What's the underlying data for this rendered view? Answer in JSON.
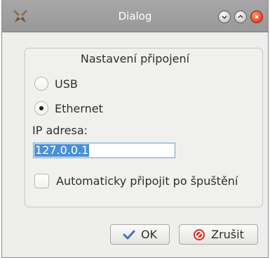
{
  "window": {
    "title": "Dialog"
  },
  "section": {
    "title": "Nastavení připojení"
  },
  "connection": {
    "options": [
      {
        "label": "USB",
        "selected": false
      },
      {
        "label": "Ethernet",
        "selected": true
      }
    ]
  },
  "ip": {
    "label": "IP adresa:",
    "value": "127.0.0.1"
  },
  "autoconnect": {
    "label": "Automaticky připojit po špuštění",
    "checked": false
  },
  "buttons": {
    "ok_label": "OK",
    "cancel_label": "Zrušit"
  },
  "icons": {
    "ok": "checkmark-icon",
    "cancel": "cancel-icon",
    "app": "app-icon",
    "minimize": "minimize-icon",
    "maximize": "maximize-icon",
    "close": "close-icon"
  },
  "colors": {
    "titlebar": "#9f9f9f",
    "selection": "#4a90d9",
    "close_button": "#e5512b",
    "ok_icon": "#4a6fb6",
    "cancel_icon": "#d6322b"
  }
}
